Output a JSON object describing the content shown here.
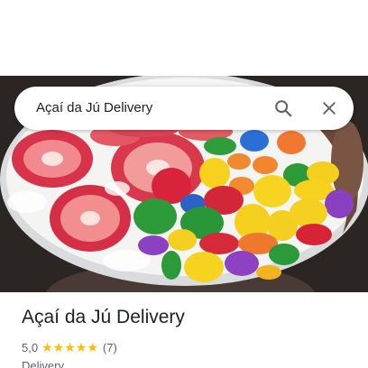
{
  "search": {
    "query": "Açaí da Jú Delivery"
  },
  "icons": {
    "search": "search-icon",
    "close": "close-icon",
    "star": "star-icon"
  },
  "place": {
    "title": "Açaí da Jú Delivery",
    "rating_value": "5,0",
    "rating": 5,
    "review_count": "(7)",
    "category": "Delivery"
  },
  "colors": {
    "star": "#fbbc04",
    "text_primary": "#202124",
    "text_secondary": "#5f6368"
  }
}
